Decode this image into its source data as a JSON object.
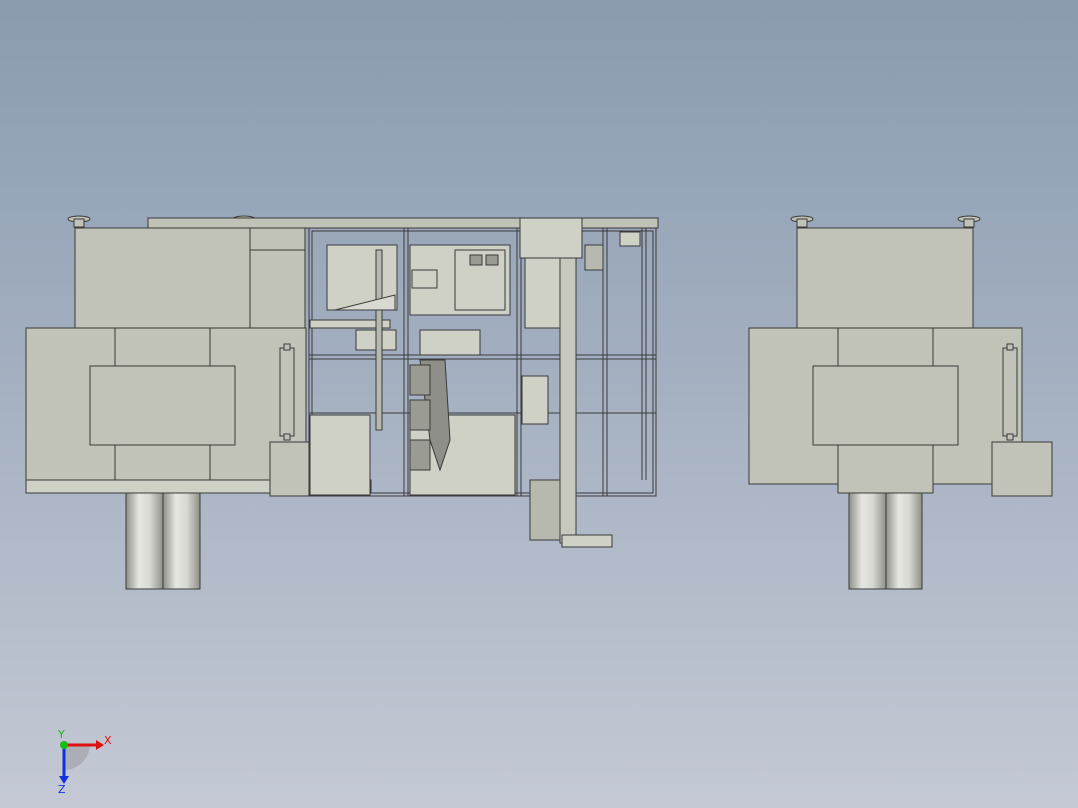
{
  "viewport": {
    "background_top": "#8a9bb0",
    "background_bottom": "#c4c9d4"
  },
  "colors": {
    "part_fill": "#c2c3b8",
    "part_fill_light": "#cfd0c6",
    "edge": "#3a3a3a",
    "cylinder_light": "#e6e6e2",
    "cylinder_dark": "#8f9088",
    "axis_x": "#e01010",
    "axis_y": "#10c010",
    "axis_z": "#1030e0"
  },
  "triad": {
    "x_label": "X",
    "y_label": "Y",
    "z_label": "Z",
    "icon": "coordinate-triad-icon"
  }
}
